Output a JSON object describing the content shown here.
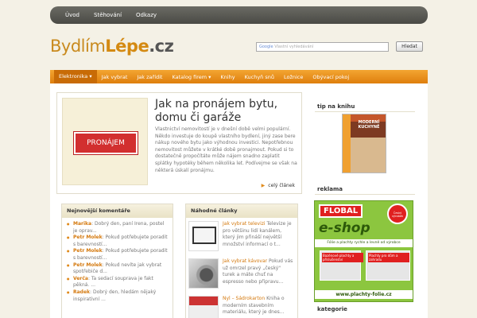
{
  "topnav": [
    "Úvod",
    "Stěhování",
    "Odkazy"
  ],
  "logo": {
    "part1": "Bydlím",
    "part2": "Lépe",
    "part3": ".cz"
  },
  "search": {
    "google": "Google",
    "placeholder": "Vlastní vyhledávání",
    "button": "Hledat"
  },
  "mainnav": [
    "Elektronika ▾",
    "Jak vybrat",
    "Jak zařídit",
    "Katalog firem ▾",
    "Knihy",
    "Kuchyň snů",
    "Ložnice",
    "Obývací pokoj"
  ],
  "feature": {
    "image_label": "PRONÁJEM",
    "title": "Jak na pronájem bytu, domu či garáže",
    "text": "Vlastnictví nemovitostí je v dnešní době velmi populární. Někdo investuje do koupě vlastního bydlení, jiný zase bere nákup nového bytu jako výhodnou investici. Nepotřebnou nemovitost můžete v krátké době pronajmout. Pokud si to dostatečně propočítáte může nájem snadno zaplatit splátky hypotéky během několika let. Podívejme se však na některá úskalí pronájmu.",
    "more": "celý článek"
  },
  "comments": {
    "title": "Nejnovější komentáře",
    "items": [
      {
        "author": "Marika",
        "text": ": Dobrý den, paní Irena, postel je oprav..."
      },
      {
        "author": "Petr Molek",
        "text": ": Pokud potřebujete poradit s barevností..."
      },
      {
        "author": "Petr Molek",
        "text": ": Pokud potřebujete poradit s barevností..."
      },
      {
        "author": "Petr Molek",
        "text": ": Pokud nevíte jak vybrat spotřebiče d..."
      },
      {
        "author": "Verča",
        "text": ": Ta sedací souprava je fakt pěkná. ..."
      },
      {
        "author": "Radek",
        "text": ": Dobrý den, hledám nějaký inspirativní ..."
      }
    ]
  },
  "random": {
    "title": "Náhodné články",
    "items": [
      {
        "link": "Jak vybrat televizi",
        "text": " Televize je pro většinu lidí kanálem, který jim přináší největší množství informací o t..."
      },
      {
        "link": "Jak vybrat kávovar",
        "text": " Pokud vás už omrzel pravý „český\" turek a máte chuť na espresso nebo připravu..."
      },
      {
        "link": "Nyl – Sádrokarton",
        "text": " Kniha o moderním stavebním materiálu, který je dnes..."
      }
    ]
  },
  "sidebar": {
    "book_title": "tip na knihu",
    "book_cover": "MODERNÍ KUCHYNĚ",
    "ad_title": "reklama",
    "categories_title": "kategorie"
  },
  "ad": {
    "brand": "FLOBAL",
    "badge": "Český výrobek",
    "name": "e-shop",
    "slogan": "Fólie a plachty rychle a levně od výrobce",
    "cap1": "Bazénové plachty a příslušenství",
    "cap2": "Plachty pro dům a zahradu",
    "url": "www.plachty-folie.cz"
  }
}
